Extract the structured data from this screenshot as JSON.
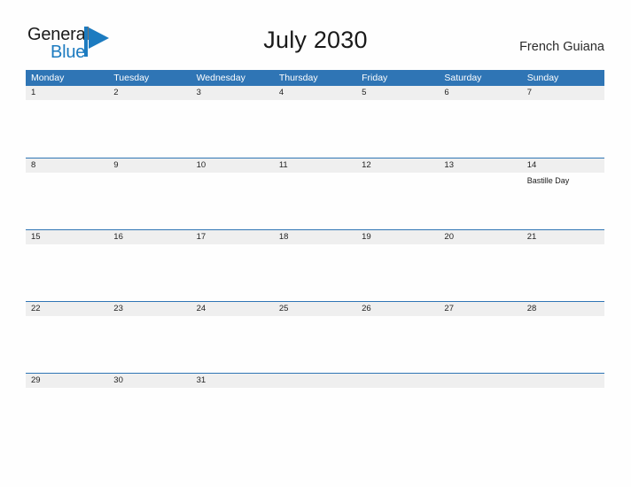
{
  "header": {
    "logo": {
      "text_primary": "General",
      "text_secondary": "Blue",
      "primary_color": "#1A1A1A",
      "secondary_color": "#1C7BC0",
      "flag_icon": "blue-flag-triangle"
    },
    "title": "July 2030",
    "locale": "French Guiana"
  },
  "theme": {
    "header_blue": "#2F75B5",
    "date_band_gray": "#EFEFEF",
    "page_background": "#FEFEFE",
    "text_dark": "#1A1A1A",
    "weekday_text": "#FFFFFF"
  },
  "calendar": {
    "weekdays": [
      "Monday",
      "Tuesday",
      "Wednesday",
      "Thursday",
      "Friday",
      "Saturday",
      "Sunday"
    ],
    "weeks": [
      [
        {
          "day": "1",
          "event": ""
        },
        {
          "day": "2",
          "event": ""
        },
        {
          "day": "3",
          "event": ""
        },
        {
          "day": "4",
          "event": ""
        },
        {
          "day": "5",
          "event": ""
        },
        {
          "day": "6",
          "event": ""
        },
        {
          "day": "7",
          "event": ""
        }
      ],
      [
        {
          "day": "8",
          "event": ""
        },
        {
          "day": "9",
          "event": ""
        },
        {
          "day": "10",
          "event": ""
        },
        {
          "day": "11",
          "event": ""
        },
        {
          "day": "12",
          "event": ""
        },
        {
          "day": "13",
          "event": ""
        },
        {
          "day": "14",
          "event": "Bastille Day"
        }
      ],
      [
        {
          "day": "15",
          "event": ""
        },
        {
          "day": "16",
          "event": ""
        },
        {
          "day": "17",
          "event": ""
        },
        {
          "day": "18",
          "event": ""
        },
        {
          "day": "19",
          "event": ""
        },
        {
          "day": "20",
          "event": ""
        },
        {
          "day": "21",
          "event": ""
        }
      ],
      [
        {
          "day": "22",
          "event": ""
        },
        {
          "day": "23",
          "event": ""
        },
        {
          "day": "24",
          "event": ""
        },
        {
          "day": "25",
          "event": ""
        },
        {
          "day": "26",
          "event": ""
        },
        {
          "day": "27",
          "event": ""
        },
        {
          "day": "28",
          "event": ""
        }
      ],
      [
        {
          "day": "29",
          "event": ""
        },
        {
          "day": "30",
          "event": ""
        },
        {
          "day": "31",
          "event": ""
        },
        {
          "day": "",
          "event": ""
        },
        {
          "day": "",
          "event": ""
        },
        {
          "day": "",
          "event": ""
        },
        {
          "day": "",
          "event": ""
        }
      ]
    ]
  }
}
